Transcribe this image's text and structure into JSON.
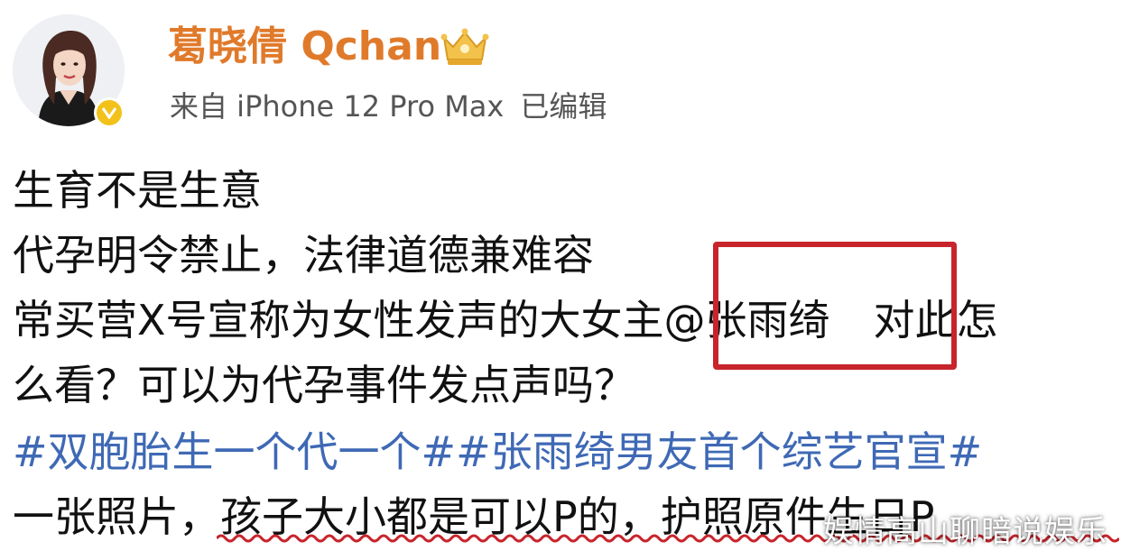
{
  "post": {
    "author": {
      "name": "葛晓倩 Qchan",
      "verified": true,
      "badge_icon": "crown-badge-icon",
      "avatar": "avatar"
    },
    "meta": {
      "source": "来自 iPhone 12 Pro Max",
      "edited": "已编辑"
    },
    "lines": [
      "生育不是生意",
      "代孕明令禁止，法律道德兼难容"
    ],
    "line3": {
      "before": "常买营X号宣称为女性发声的大女主",
      "mention": "@张雨绮",
      "after": "对此怎"
    },
    "line4": "么看？可以为代孕事件发点声吗？",
    "hashtags": "#双胞胎生一个代一个##张雨绮男友首个综艺官宣#",
    "line6": "一张照片，孩子大小都是可以P的，护照原件生日P"
  },
  "watermark": "娱情高山聊暗说娱乐",
  "colors": {
    "name": "#e07a2b",
    "hashtag": "#3f69b5",
    "highlight": "#c8242b",
    "verified": "#f2c21b"
  }
}
